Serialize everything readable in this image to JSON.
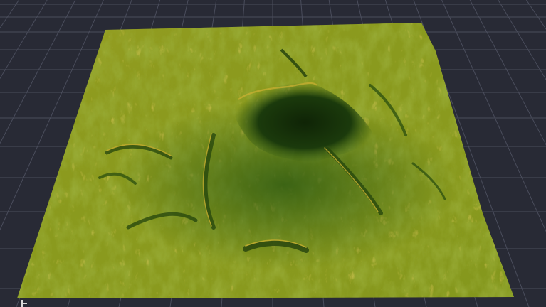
{
  "viewport": {
    "background_color": "#282a35",
    "grid_color": "#4a4d5c",
    "terrain": {
      "base_color": "#8a9a1e",
      "highlight_color": "#c0a82a",
      "shadow_color": "#2c5210",
      "crater_color": "#16300a",
      "icon": "terrain-heightmap"
    }
  }
}
